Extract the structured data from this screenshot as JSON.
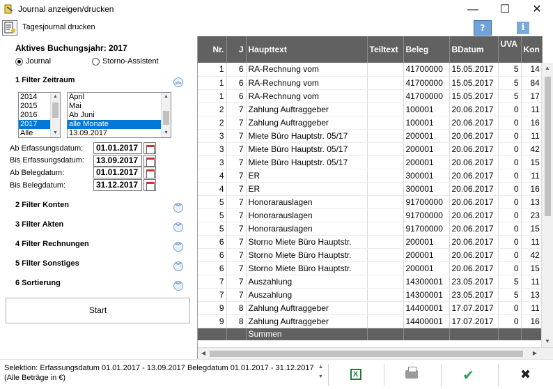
{
  "window": {
    "title": "Journal anzeigen/drucken",
    "minimize": "—",
    "maximize": "☐",
    "close": "✕"
  },
  "toolbar": {
    "label": "Tagesjournal drucken",
    "help": "?",
    "info": "i"
  },
  "left": {
    "buchungsjahr": "Aktives Buchungsjahr: 2017",
    "radio_journal": "Journal",
    "radio_storno": "Storno-Assistent",
    "sections": {
      "zeitraum": "1 Filter Zeitraum",
      "konten": "2 Filter Konten",
      "akten": "3 Filter Akten",
      "rechnungen": "4 Filter Rechnungen",
      "sonstiges": "5 Filter Sonstiges",
      "sortierung": "6 Sortierung"
    },
    "years": [
      "2014",
      "2015",
      "2016",
      "2017",
      "Alle"
    ],
    "months": [
      "April",
      "Mai",
      "Ab Juni",
      "alle Monate",
      "13.09.2017"
    ],
    "dates": [
      {
        "label": "Ab Erfassungsdatum:",
        "value": "01.01.2017"
      },
      {
        "label": "Bis Erfassungsdatum:",
        "value": "13.09.2017"
      },
      {
        "label": "Ab Belegdatum:",
        "value": "01.01.2017"
      },
      {
        "label": "Bis Belegdatum:",
        "value": "31.12.2017"
      }
    ],
    "start": "Start"
  },
  "grid": {
    "headers": [
      "Nr.",
      "J",
      "Haupttext",
      "Teiltext",
      "Beleg",
      "BDatum",
      "UVA",
      "Kon"
    ],
    "rows": [
      [
        "1",
        "6",
        "RA-Rechnung vom",
        "",
        "41700000",
        "15.05.2017",
        "5",
        "14"
      ],
      [
        "1",
        "6",
        "RA-Rechnung vom",
        "",
        "41700000",
        "15.05.2017",
        "5",
        "84"
      ],
      [
        "1",
        "6",
        "RA-Rechnung vom",
        "",
        "41700000",
        "15.05.2017",
        "5",
        "17"
      ],
      [
        "2",
        "7",
        "Zahlung Auftraggeber",
        "",
        "100001",
        "20.06.2017",
        "0",
        "11"
      ],
      [
        "2",
        "7",
        "Zahlung Auftraggeber",
        "",
        "100001",
        "20.06.2017",
        "0",
        "16"
      ],
      [
        "3",
        "7",
        "Miete Büro Hauptstr. 05/17",
        "",
        "200001",
        "20.06.2017",
        "0",
        "11"
      ],
      [
        "3",
        "7",
        "Miete Büro Hauptstr. 05/17",
        "",
        "200001",
        "20.06.2017",
        "0",
        "42"
      ],
      [
        "3",
        "7",
        "Miete Büro Hauptstr. 05/17",
        "",
        "200001",
        "20.06.2017",
        "0",
        "15"
      ],
      [
        "4",
        "7",
        "ER",
        "",
        "300001",
        "20.06.2017",
        "0",
        "11"
      ],
      [
        "4",
        "7",
        "ER",
        "",
        "300001",
        "20.06.2017",
        "0",
        "16"
      ],
      [
        "5",
        "7",
        "Honorarauslagen",
        "",
        "91700000",
        "20.06.2017",
        "0",
        "13"
      ],
      [
        "5",
        "7",
        "Honorarauslagen",
        "",
        "91700000",
        "20.06.2017",
        "0",
        "23"
      ],
      [
        "5",
        "7",
        "Honorarauslagen",
        "",
        "91700000",
        "20.06.2017",
        "0",
        "15"
      ],
      [
        "6",
        "7",
        "Storno Miete Büro Hauptstr.",
        "",
        "200001",
        "20.06.2017",
        "0",
        "11"
      ],
      [
        "6",
        "7",
        "Storno Miete Büro Hauptstr.",
        "",
        "200001",
        "20.06.2017",
        "0",
        "42"
      ],
      [
        "6",
        "7",
        "Storno Miete Büro Hauptstr.",
        "",
        "200001",
        "20.06.2017",
        "0",
        "15"
      ],
      [
        "7",
        "7",
        "Auszahlung",
        "",
        "14300001",
        "23.05.2017",
        "5",
        "11"
      ],
      [
        "7",
        "7",
        "Auszahlung",
        "",
        "14300001",
        "23.05.2017",
        "5",
        "13"
      ],
      [
        "9",
        "8",
        "Zahlung Auftraggeber",
        "",
        "14400001",
        "17.07.2017",
        "0",
        "11"
      ],
      [
        "9",
        "8",
        "Zahlung Auftraggeber",
        "",
        "14400001",
        "17.07.2017",
        "0",
        "16"
      ]
    ],
    "summen": "Summen"
  },
  "status": {
    "line1": "Selektion: Erfassungsdatum 01.01.2017 - 13.09.2017 Belegdatum 01.01.2017 - 31.12.2017",
    "line2": "(Alle Beträge in €)"
  },
  "footer": {
    "excel": "X",
    "ok": "✔",
    "cancel": "✖"
  }
}
